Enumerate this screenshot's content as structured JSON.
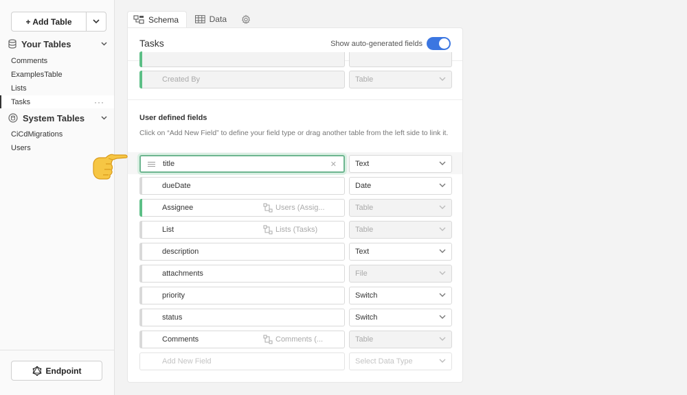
{
  "sidebar": {
    "add_table_label": "+ Add Table",
    "your_tables_label": "Your Tables",
    "your_tables": [
      "Comments",
      "ExamplesTable",
      "Lists",
      "Tasks"
    ],
    "active_table": "Tasks",
    "system_tables_label": "System Tables",
    "system_tables": [
      "CiCdMigrations",
      "Users"
    ],
    "endpoint_label": "Endpoint"
  },
  "tabs": [
    {
      "label": "Schema",
      "icon": "schema-icon",
      "active": true
    },
    {
      "label": "Data",
      "icon": "table-icon",
      "active": false
    },
    {
      "label": "",
      "icon": "gear-icon",
      "active": false
    }
  ],
  "panel": {
    "title": "Tasks",
    "toggle_label": "Show auto-generated fields",
    "toggle_on": true,
    "auto_field": {
      "name": "Created By",
      "type": "Table"
    },
    "user_defined_title": "User defined fields",
    "user_defined_desc": "Click on “Add New Field” to define your field type or drag another table from the left side to link it.",
    "fields": [
      {
        "name": "title",
        "type": "Text",
        "link": "",
        "selected": true
      },
      {
        "name": "dueDate",
        "type": "Date",
        "link": ""
      },
      {
        "name": "Assignee",
        "type": "Table",
        "link": "Users (Assig..."
      },
      {
        "name": "List",
        "type": "Table",
        "link": "Lists (Tasks)"
      },
      {
        "name": "description",
        "type": "Text",
        "link": ""
      },
      {
        "name": "attachments",
        "type": "File",
        "link": ""
      },
      {
        "name": "priority",
        "type": "Switch",
        "link": ""
      },
      {
        "name": "status",
        "type": "Switch",
        "link": ""
      },
      {
        "name": "Comments",
        "type": "Table",
        "link": "Comments (..."
      }
    ],
    "new_field_placeholder": "Add New Field",
    "new_type_placeholder": "Select Data Type"
  },
  "colors": {
    "accent": "#3b76e1",
    "link_bar": "#5cbf86",
    "selected_border": "#6cb58f"
  }
}
